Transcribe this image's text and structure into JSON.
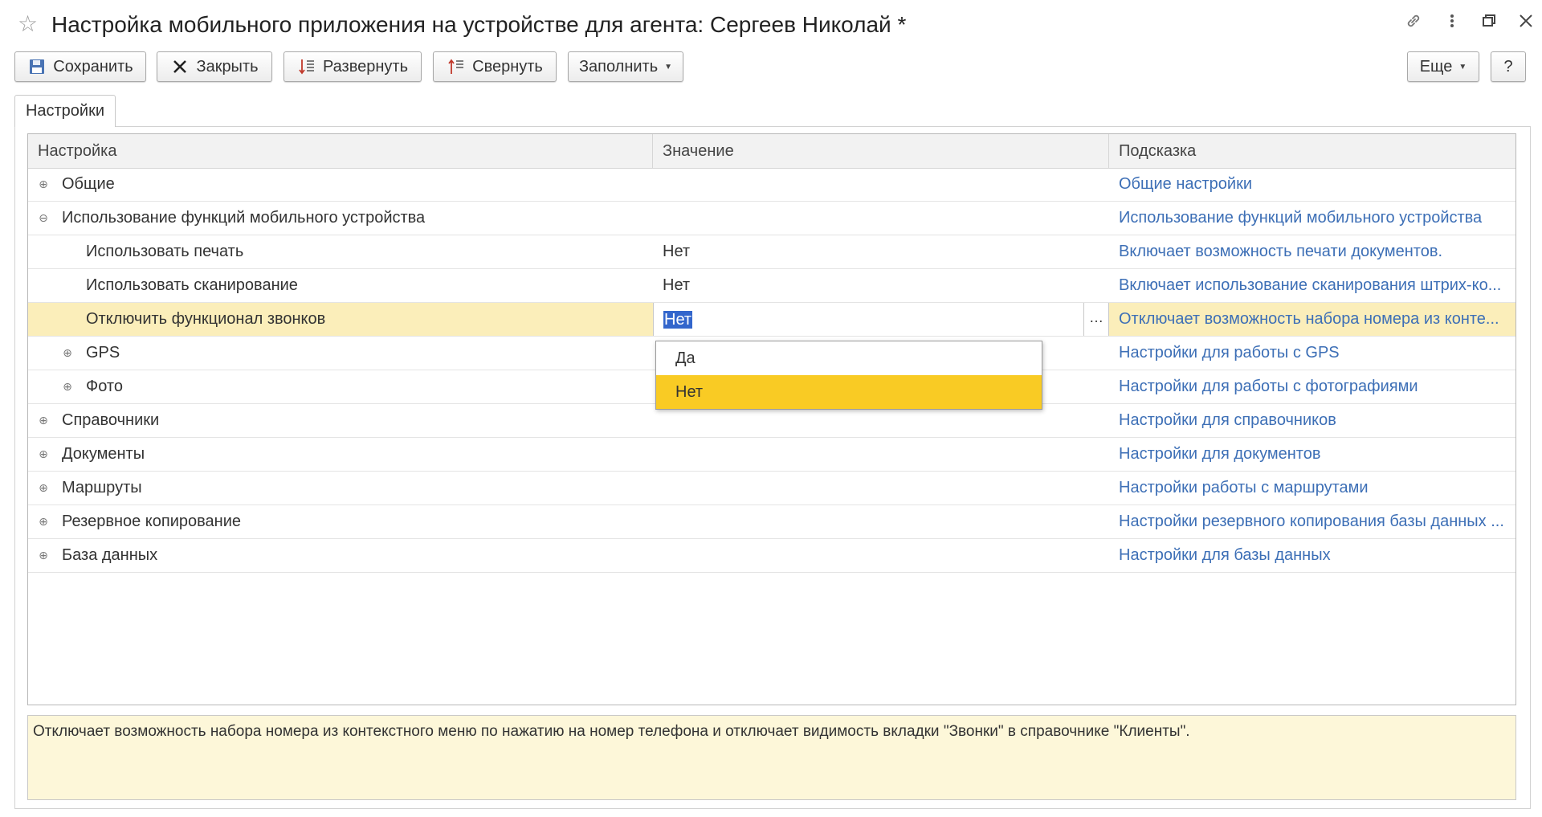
{
  "window": {
    "title": "Настройка мобильного приложения на устройстве для агента: Сергеев Николай *",
    "icons": [
      "star-icon",
      "link-icon",
      "more-vertical-icon",
      "restore-window-icon",
      "close-icon"
    ]
  },
  "toolbar": {
    "save": "Сохранить",
    "close": "Закрыть",
    "expand": "Развернуть",
    "collapse": "Свернуть",
    "fill": "Заполнить",
    "more": "Еще",
    "help": "?"
  },
  "tabs": [
    {
      "label": "Настройки",
      "active": true
    }
  ],
  "grid": {
    "columns": [
      "Настройка",
      "Значение",
      "Подсказка"
    ],
    "rows": [
      {
        "name": "Общие",
        "value": "",
        "hint": "Общие настройки",
        "level": 0,
        "expander": "plus"
      },
      {
        "name": "Использование функций мобильного устройства",
        "value": "",
        "hint": "Использование функций мобильного устройства",
        "level": 0,
        "expander": "minus"
      },
      {
        "name": "Использовать печать",
        "value": "Нет",
        "hint": "Включает возможность печати документов.",
        "level": 1,
        "expander": "none"
      },
      {
        "name": "Использовать сканирование",
        "value": "Нет",
        "hint": "Включает использование сканирования штрих-ко...",
        "level": 1,
        "expander": "none"
      },
      {
        "name": "Отключить функционал звонков",
        "value": "Нет",
        "hint": "Отключает возможность набора номера из конте...",
        "level": 1,
        "expander": "none",
        "selected": true
      },
      {
        "name": "GPS",
        "value": "",
        "hint": "Настройки для работы с GPS",
        "level": 1,
        "expander": "plus"
      },
      {
        "name": "Фото",
        "value": "",
        "hint": "Настройки для работы с фотографиями",
        "level": 1,
        "expander": "plus"
      },
      {
        "name": "Справочники",
        "value": "",
        "hint": "Настройки для справочников",
        "level": 0,
        "expander": "plus"
      },
      {
        "name": "Документы",
        "value": "",
        "hint": "Настройки для документов",
        "level": 0,
        "expander": "plus"
      },
      {
        "name": "Маршруты",
        "value": "",
        "hint": "Настройки работы с маршрутами",
        "level": 0,
        "expander": "plus"
      },
      {
        "name": "Резервное копирование",
        "value": "",
        "hint": "Настройки резервного копирования базы данных ...",
        "level": 0,
        "expander": "plus"
      },
      {
        "name": "База данных",
        "value": "",
        "hint": "Настройки для базы данных",
        "level": 0,
        "expander": "plus"
      }
    ]
  },
  "dropdown": {
    "options": [
      "Да",
      "Нет"
    ],
    "highlighted": "Нет"
  },
  "description": "Отключает возможность набора номера из контекстного меню по нажатию на номер телефона и отключает видимость вкладки \"Звонки\" в справочнике \"Клиенты\".",
  "colors": {
    "hint_link": "#3d6fb6",
    "selected_row": "#fbeeba",
    "dropdown_highlight": "#f9cb24",
    "text_selection": "#3366cc",
    "description_bg": "#fdf7d9"
  }
}
